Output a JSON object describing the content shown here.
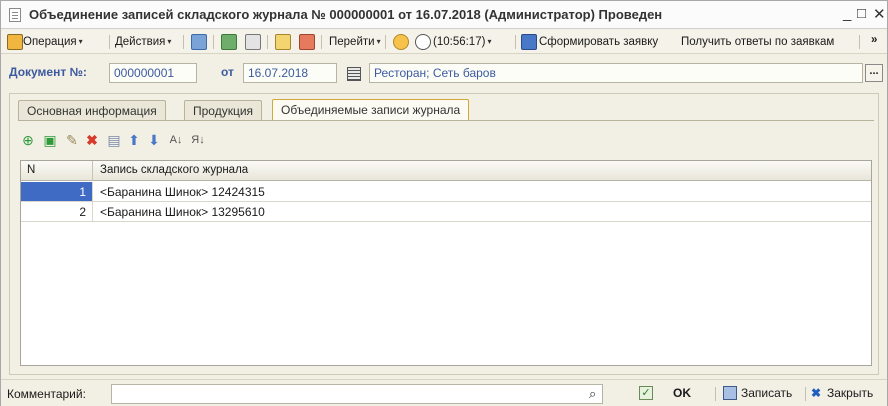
{
  "window": {
    "title": "Объединение записей складского журнала № 000000001 от 16.07.2018 (Администратор) Проведен",
    "minimize_glyph": "_",
    "maximize_glyph": "□",
    "close_glyph": "✕"
  },
  "toolbar": {
    "operation_label": "Операция",
    "actions_label": "Действия",
    "goto_label": "Перейти",
    "time_label": "(10:56:17)",
    "form_request_label": "Сформировать заявку",
    "get_answers_label": "Получить ответы по заявкам",
    "more_glyph": "»",
    "caret_glyph": "▾"
  },
  "document": {
    "number_label": "Документ №:",
    "number_value": "000000001",
    "date_label": "от",
    "date_value": "16.07.2018",
    "warehouse_value": "Ресторан; Сеть баров",
    "select_button": "..."
  },
  "tabs": [
    {
      "label": "Основная информация",
      "active": false
    },
    {
      "label": "Продукция",
      "active": false
    },
    {
      "label": "Объединяемые записи журнала",
      "active": true
    }
  ],
  "grid_toolbar": {
    "icons": [
      "add-icon",
      "copy-icon",
      "edit-icon",
      "delete-icon",
      "save-row-icon",
      "move-up-icon",
      "move-down-icon",
      "sort-asc-icon",
      "sort-desc-icon"
    ]
  },
  "table": {
    "headers": {
      "n": "N",
      "record": "Запись складского журнала"
    },
    "rows": [
      {
        "n": "1",
        "record": "<Баранина Шинок> 12424315",
        "selected": true
      },
      {
        "n": "2",
        "record": "<Баранина Шинок> 13295610",
        "selected": false
      }
    ]
  },
  "bottom": {
    "comment_label": "Комментарий:",
    "ok_label": "OK",
    "save_label": "Записать",
    "close_label": "Закрыть"
  },
  "colors": {
    "accent_blue": "#3c5aa0",
    "selection": "#3f6bc4",
    "active_tab_border": "#d2a83a"
  }
}
